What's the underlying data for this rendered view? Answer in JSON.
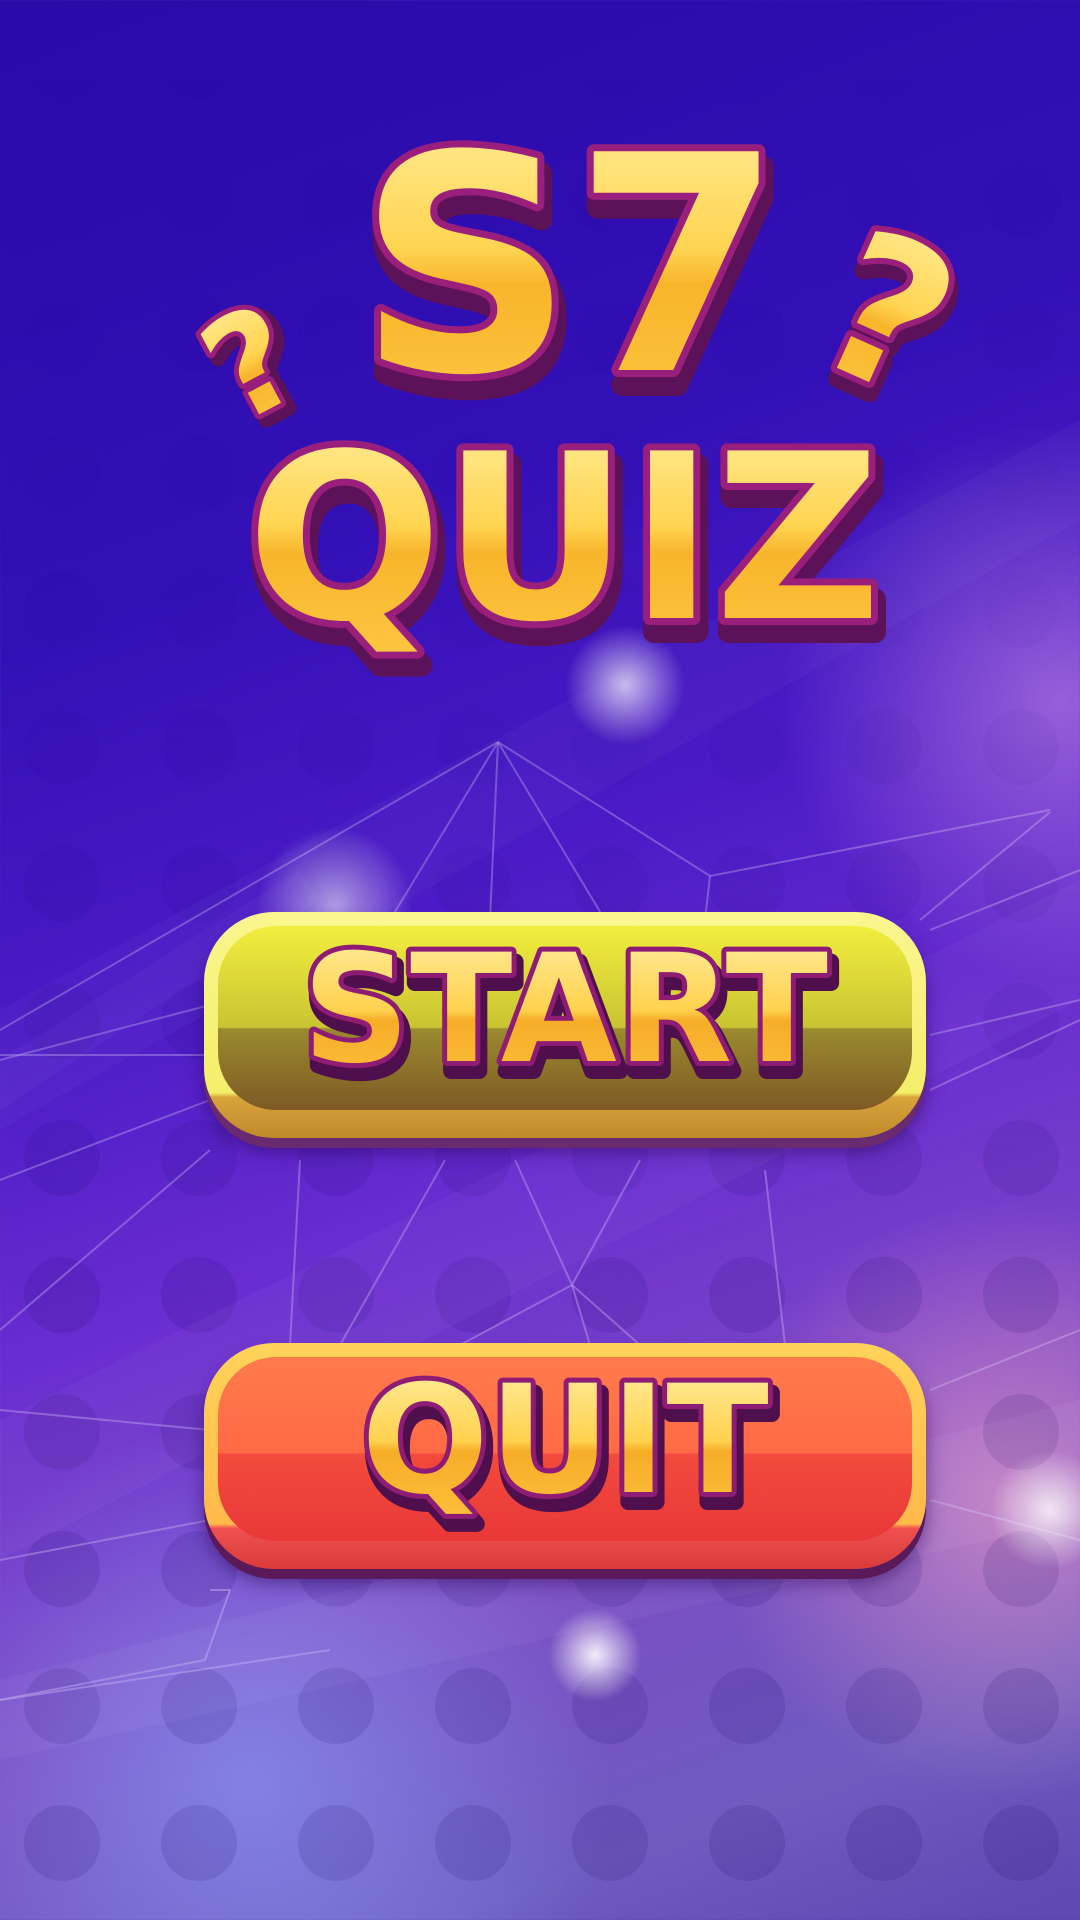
{
  "title": {
    "line1": "S7",
    "line2": "QUIZ",
    "question_mark": "?"
  },
  "menu": {
    "start_label": "START",
    "quit_label": "QUIT"
  },
  "colors": {
    "text_gold_top": "#ffe07a",
    "text_gold_bottom": "#f5a623",
    "text_outline": "#8a1a6e",
    "start_button": "#e8e43a",
    "quit_button": "#f5503f",
    "background": "#3410b8"
  }
}
